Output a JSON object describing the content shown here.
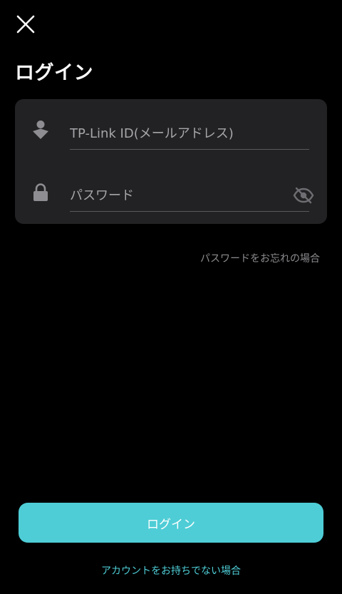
{
  "header": {
    "title": "ログイン"
  },
  "form": {
    "email": {
      "placeholder": "TP-Link ID(メールアドレス)",
      "value": ""
    },
    "password": {
      "placeholder": "パスワード",
      "value": ""
    }
  },
  "links": {
    "forgot_password": "パスワードをお忘れの場合",
    "no_account": "アカウントをお持ちでない場合"
  },
  "actions": {
    "login_label": "ログイン"
  },
  "colors": {
    "background": "#000000",
    "card": "#222224",
    "accent": "#4ecdd6",
    "muted_text": "#8c8c90",
    "icon": "#8e8e92"
  },
  "icons": {
    "close": "close-icon",
    "user": "user-icon",
    "lock": "lock-icon",
    "visibility": "eye-off-icon"
  }
}
